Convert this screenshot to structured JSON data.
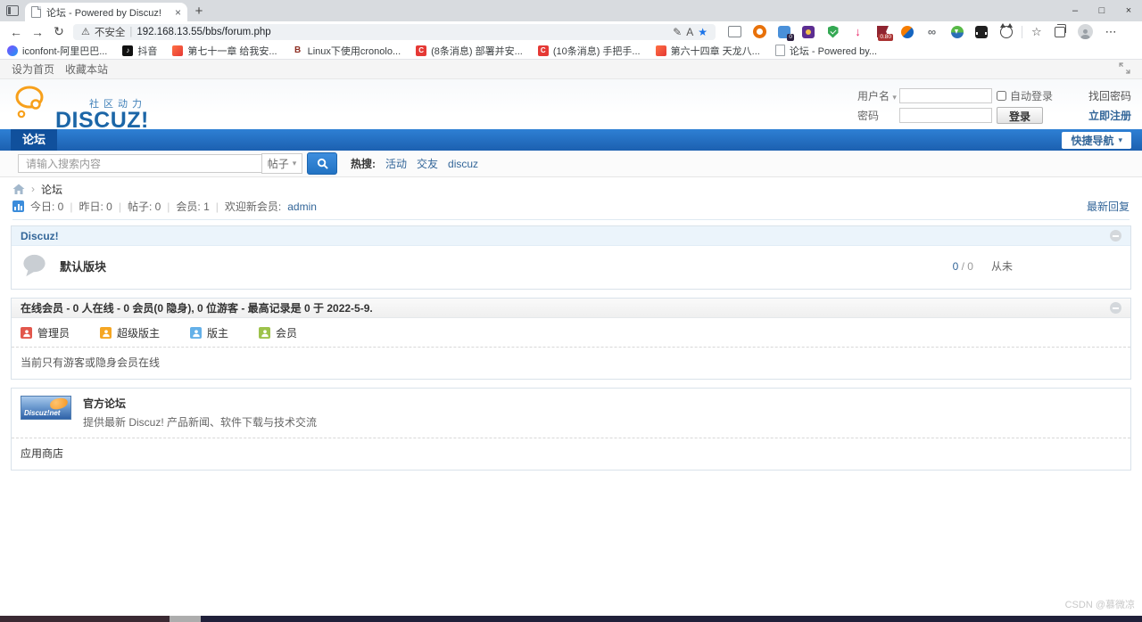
{
  "icons": {
    "back": "←",
    "forward": "→",
    "refresh": "↻",
    "warning": "⚠",
    "pen": "✎",
    "read_aloud": "A",
    "star": "★",
    "infinity": "∞",
    "more": "⋯",
    "caret": "▾",
    "chevron": "›",
    "pipe": "|",
    "slash": "/",
    "plus": "+",
    "close": "×",
    "minimize": "–",
    "maximize": "□",
    "fav_list": "☆",
    "pink_arrow": "↓"
  },
  "browser": {
    "tab_title": "论坛 - Powered by Discuz!",
    "security_label": "不安全",
    "url": "192.168.13.55/bbs/forum.php",
    "extensions": [
      {
        "name": "reading-list",
        "badge": ""
      },
      {
        "name": "orange-ring",
        "badge": ""
      },
      {
        "name": "blue-app",
        "badge": "0"
      },
      {
        "name": "purple-app",
        "badge": ""
      },
      {
        "name": "green-shield",
        "badge": ""
      },
      {
        "name": "pink-arrow",
        "badge": ""
      },
      {
        "name": "red-flag",
        "badge": "0.80"
      },
      {
        "name": "orange-blue-globe",
        "badge": ""
      },
      {
        "name": "infinity",
        "badge": ""
      },
      {
        "name": "idm-downloader",
        "badge": ""
      },
      {
        "name": "dark-widget",
        "badge": ""
      },
      {
        "name": "cat-extension",
        "badge": ""
      }
    ],
    "bookmarks": [
      {
        "label": "iconfont-阿里巴巴..."
      },
      {
        "label": "抖音"
      },
      {
        "label": "第七十一章 给我安..."
      },
      {
        "label": "Linux下使用cronolo..."
      },
      {
        "label": "(8条消息) 部署并安..."
      },
      {
        "label": "(10条消息) 手把手..."
      },
      {
        "label": "第六十四章 天龙八..."
      },
      {
        "label": "论坛 - Powered by..."
      }
    ],
    "bookmark4_letter": "B"
  },
  "shortcut": {
    "set_home": "设为首页",
    "add_fav": "收藏本站"
  },
  "header": {
    "tagline": "社区动力",
    "brand": "DISCUZ!",
    "login": {
      "username_label": "用户名",
      "password_label": "密码",
      "auto_login": "自动登录",
      "find_password": "找回密码",
      "login_btn": "登录",
      "register": "立即注册"
    }
  },
  "nav": {
    "forum_tab": "论坛",
    "quick_nav": "快捷导航"
  },
  "search": {
    "placeholder": "请输入搜索内容",
    "type_label": "帖子",
    "hot_label": "热搜:",
    "links": [
      {
        "label": "活动"
      },
      {
        "label": "交友"
      },
      {
        "label": "discuz"
      }
    ]
  },
  "breadcrumb": {
    "forum": "论坛"
  },
  "stats": {
    "today": "今日: 0",
    "yesterday": "昨日: 0",
    "posts": "帖子: 0",
    "members": "会员: 1",
    "welcome": "欢迎新会员:",
    "newest": "admin",
    "latest_reply": "最新回复"
  },
  "category": {
    "title": "Discuz!",
    "forum_name": "默认版块",
    "threads": "0",
    "posts_count": "0",
    "last_post": "从未"
  },
  "online": {
    "title": "在线会员 - 0 人在线 - 0 会员(0 隐身), 0 位游客 - 最高记录是 0 于 2022-5-9.",
    "legend": [
      {
        "label": "管理员"
      },
      {
        "label": "超级版主"
      },
      {
        "label": "版主"
      },
      {
        "label": "会员"
      }
    ],
    "notice": "当前只有游客或隐身会员在线"
  },
  "official": {
    "logo_text": "Discuz!net",
    "title": "官方论坛",
    "desc": "提供最新 Discuz! 产品新闻、软件下载与技术交流",
    "appstore": "应用商店"
  },
  "watermark": "CSDN @慕微凉",
  "colors": {
    "brand_blue": "#1C66A7",
    "link_blue": "#336699",
    "nav_blue_top": "#2E80D4",
    "nav_blue_bottom": "#1C60B0",
    "accent_orange": "#F7941D",
    "csdn_red": "#E53935"
  }
}
